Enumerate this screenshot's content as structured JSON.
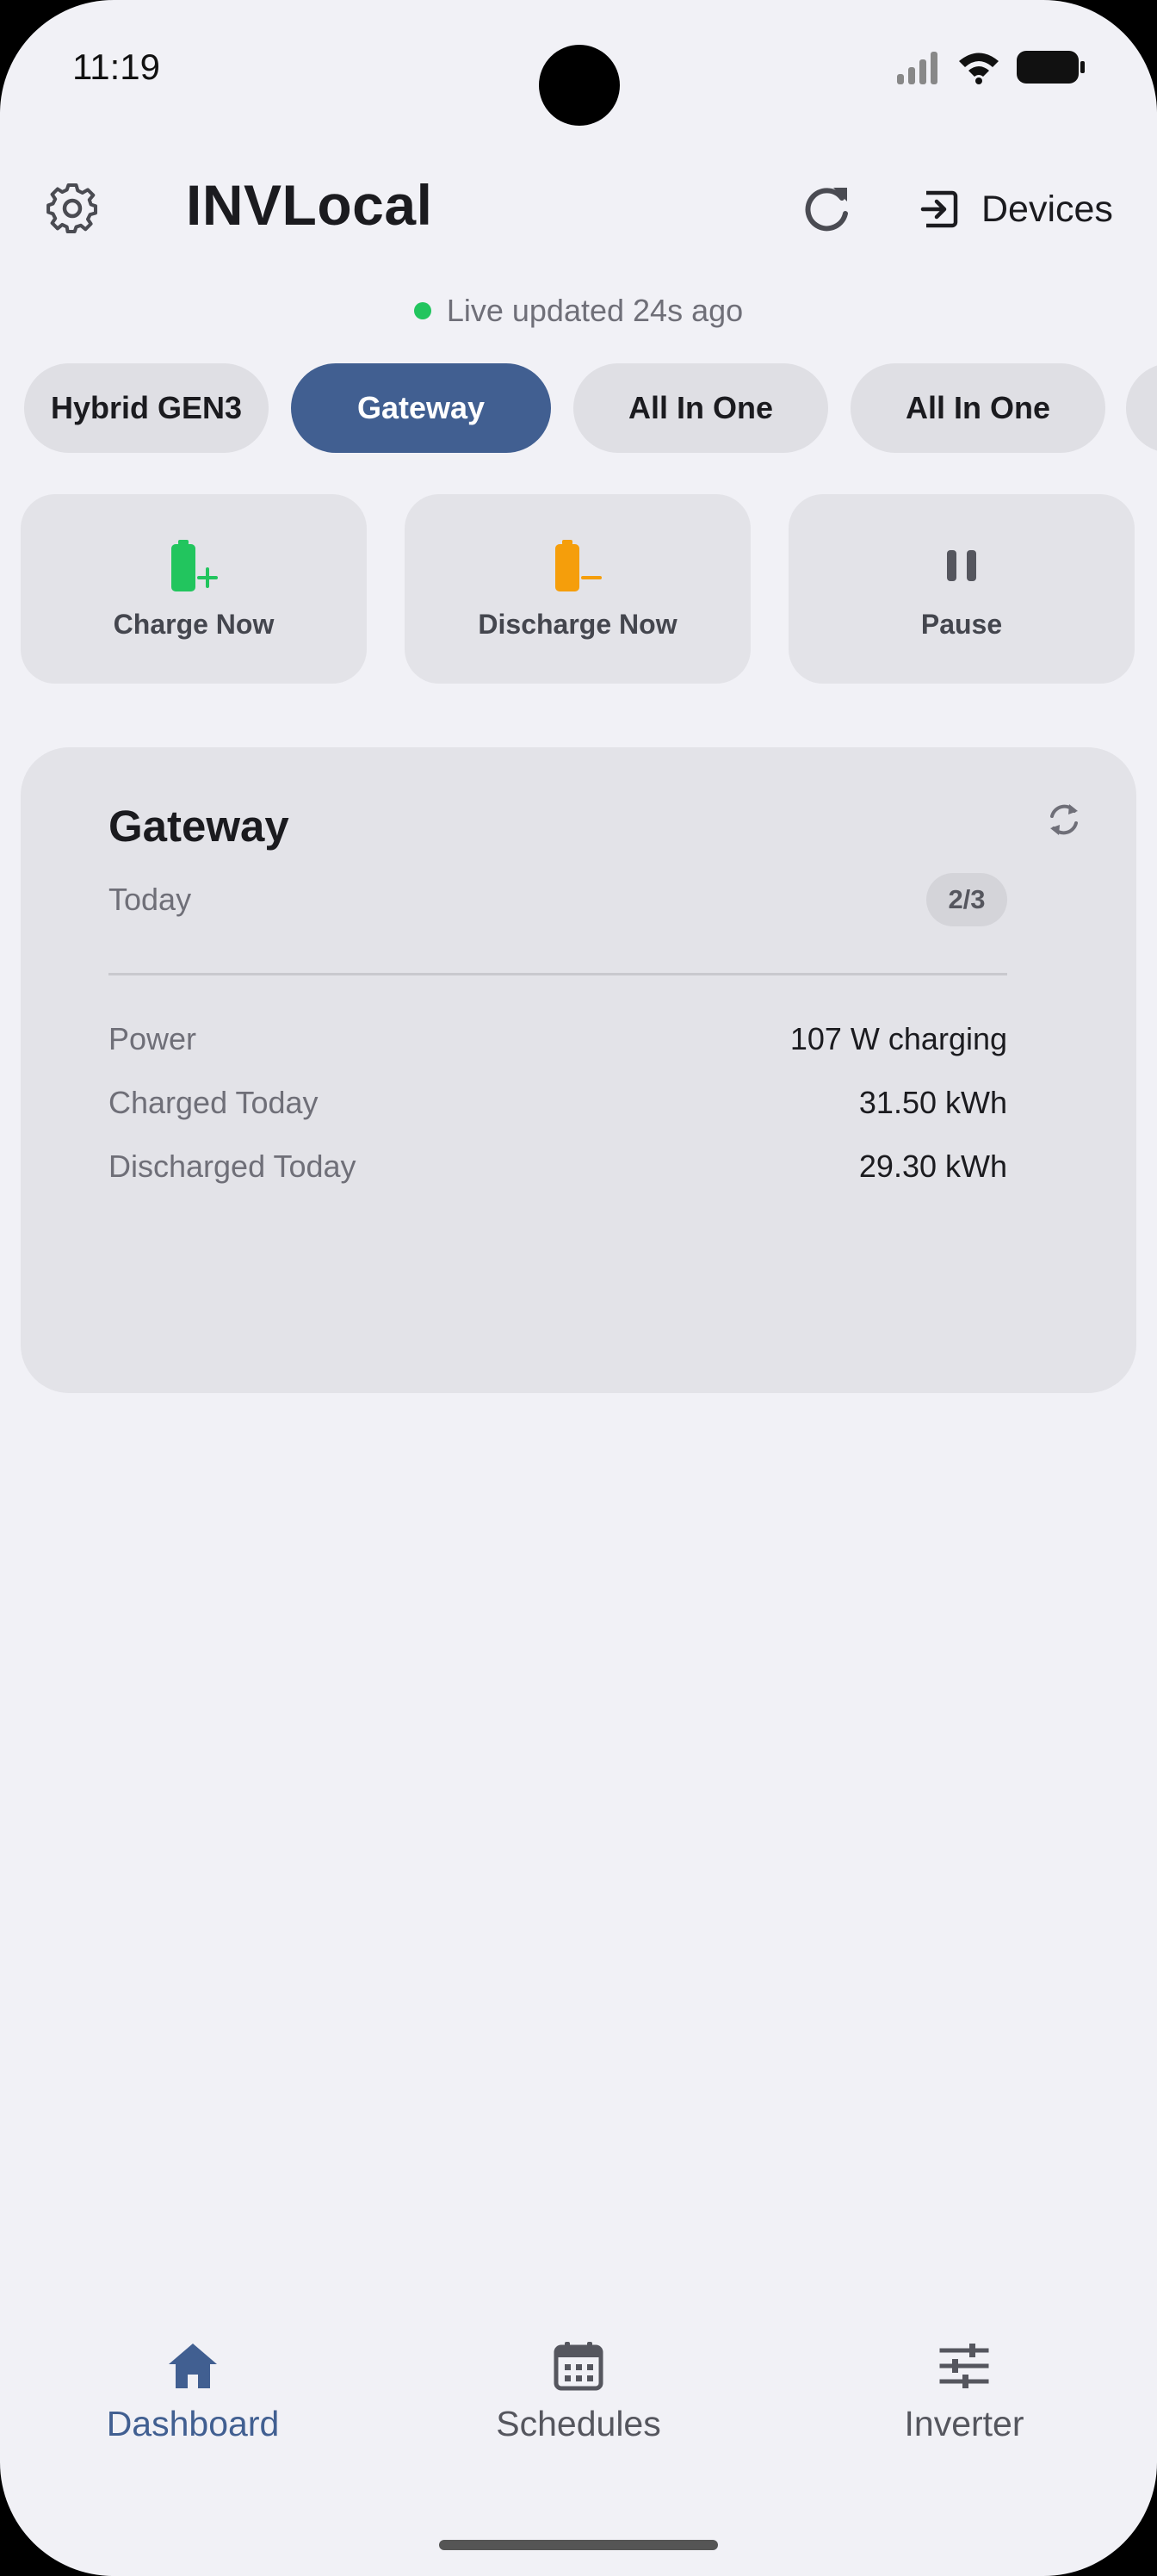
{
  "status_bar": {
    "time": "11:19"
  },
  "header": {
    "title": "INVLocal",
    "devices_label": "Devices",
    "live_text": "Live updated 24s ago"
  },
  "device_tabs": [
    {
      "label": "Hybrid GEN3",
      "active": false
    },
    {
      "label": "Gateway",
      "active": true
    },
    {
      "label": "All In One",
      "active": false
    },
    {
      "label": "All In One",
      "active": false
    }
  ],
  "actions": [
    {
      "label": "Charge Now",
      "icon": "battery-charge-icon",
      "color": "#22c55e"
    },
    {
      "label": "Discharge Now",
      "icon": "battery-discharge-icon",
      "color": "#f59e0b"
    },
    {
      "label": "Pause",
      "icon": "pause-icon",
      "color": "#55565e"
    }
  ],
  "card": {
    "title": "Gateway",
    "subtitle": "Today",
    "page_badge": "2/3",
    "rows": [
      {
        "label": "Power",
        "value": "107 W charging"
      },
      {
        "label": "Charged Today",
        "value": "31.50 kWh"
      },
      {
        "label": "Discharged Today",
        "value": "29.30 kWh"
      }
    ]
  },
  "bottom_nav": [
    {
      "label": "Dashboard",
      "icon": "home-icon",
      "active": true
    },
    {
      "label": "Schedules",
      "icon": "calendar-icon",
      "active": false
    },
    {
      "label": "Inverter",
      "icon": "sliders-icon",
      "active": false
    }
  ],
  "colors": {
    "accent": "#415f91",
    "live_dot": "#22c55e",
    "charge": "#22c55e",
    "discharge": "#f59e0b"
  }
}
